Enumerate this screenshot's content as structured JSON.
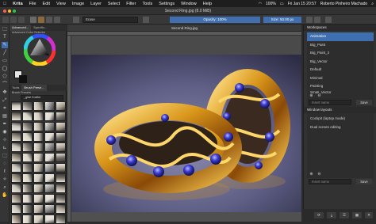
{
  "menubar": {
    "app": "Krita",
    "items": [
      "File",
      "Edit",
      "View",
      "Image",
      "Layer",
      "Select",
      "Filter",
      "Tools",
      "Settings",
      "Window",
      "Help"
    ],
    "battery": "100%",
    "datetime": "Fri Jan 15 20:57",
    "user": "Roberto Pinheiro Machado"
  },
  "window": {
    "title": "Second Ring.jpg (8.0 MiB)"
  },
  "toolbar": {
    "blend_mode": "Erase",
    "opacity_label": "Opacity: 100%",
    "size_label": "Size: 50.00 px"
  },
  "left_panel": {
    "tabs": [
      "Advanced...",
      "Specific..."
    ],
    "selector_title": "Advanced Color Selector",
    "brush_tabs": [
      "Tools",
      "Brush Prese..."
    ],
    "brush_presets_label": "Brush Presets",
    "brush_tag": "_gital Krafter",
    "colors": {
      "fg": "#e6e6e6",
      "bg": "#111111"
    }
  },
  "canvas": {
    "tab_title": "Second Ring.jpg"
  },
  "workspaces": {
    "title": "Workspaces",
    "items": [
      "Animation",
      "Big_Paint",
      "Big_Paint_2",
      "Big_Vector",
      "Default",
      "Minimal",
      "Painting",
      "Small_Vector"
    ],
    "input_placeholder": "Insert name",
    "save_label": "Save"
  },
  "window_layouts": {
    "title": "Window layouts",
    "items": [
      "Cockpit (laptop mode)",
      "Dual screen editing"
    ],
    "input_placeholder": "Insert name",
    "save_label": "Save"
  },
  "accent": "#3f6fae"
}
